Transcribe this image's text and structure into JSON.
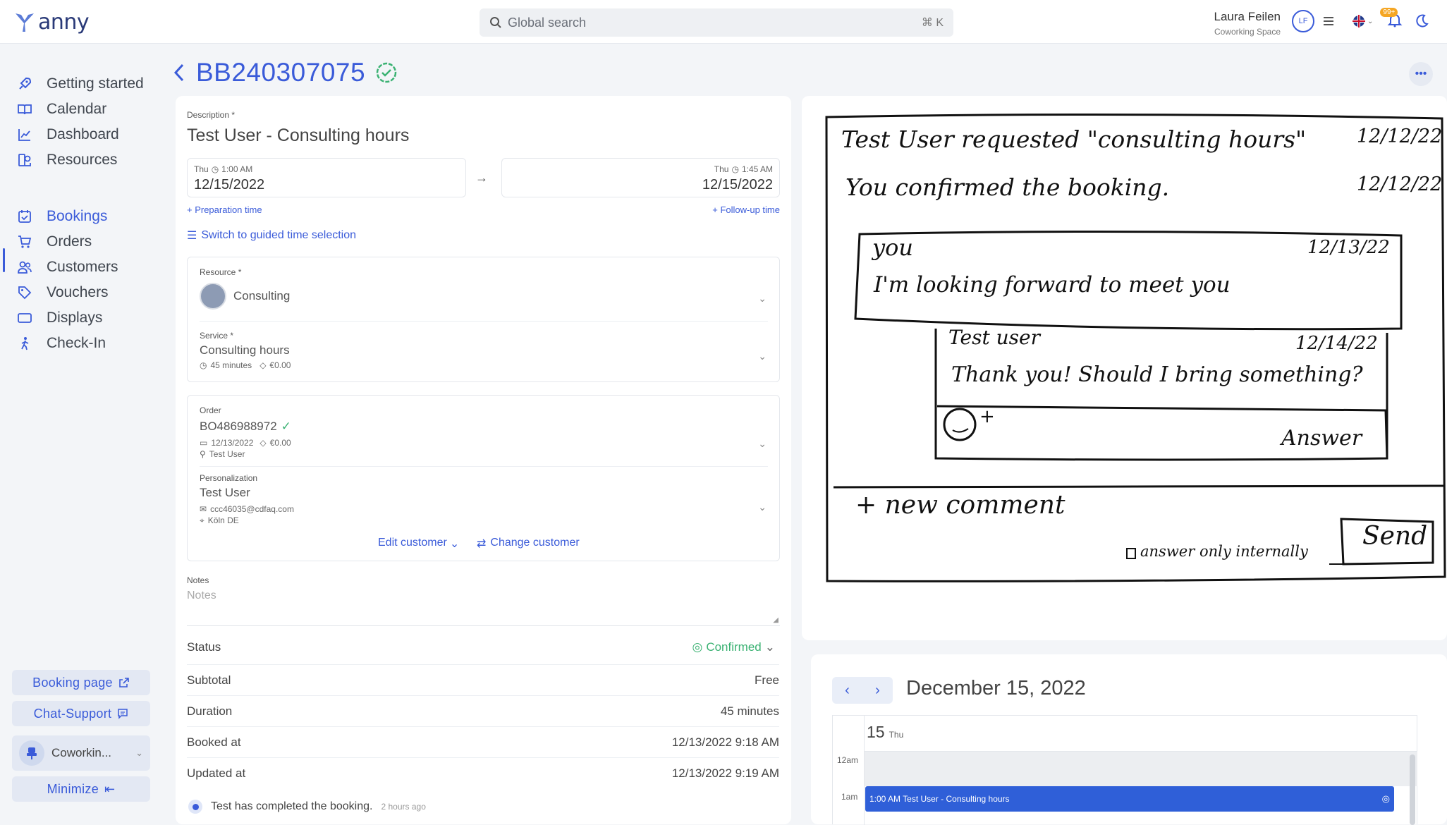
{
  "topbar": {
    "logo_text": "anny",
    "search_placeholder": "Global search",
    "search_shortcut": "⌘ K",
    "user_name": "Laura Feilen",
    "user_space": "Coworking Space",
    "user_initials": "LF",
    "notif_badge": "99+"
  },
  "sidebar": {
    "items": [
      {
        "label": "Getting started",
        "icon": "rocket-icon"
      },
      {
        "label": "Calendar",
        "icon": "book-open-icon"
      },
      {
        "label": "Dashboard",
        "icon": "chart-line-icon"
      },
      {
        "label": "Resources",
        "icon": "resources-icon"
      },
      {
        "label": "Bookings",
        "icon": "calendar-check-icon",
        "active": true
      },
      {
        "label": "Orders",
        "icon": "cart-icon"
      },
      {
        "label": "Customers",
        "icon": "users-icon"
      },
      {
        "label": "Vouchers",
        "icon": "tag-icon"
      },
      {
        "label": "Displays",
        "icon": "display-icon"
      },
      {
        "label": "Check-In",
        "icon": "walk-icon"
      }
    ],
    "booking_page": "Booking page",
    "chat_support": "Chat-Support",
    "space_name": "Coworkin...",
    "minimize": "Minimize"
  },
  "booking": {
    "id": "BB240307075",
    "description_label": "Description *",
    "description": "Test User - Consulting hours",
    "start_day": "Thu",
    "start_time": "1:00 AM",
    "start_date": "12/15/2022",
    "end_day": "Thu",
    "end_time": "1:45 AM",
    "end_date": "12/15/2022",
    "preparation_time": "+ Preparation time",
    "followup_time": "+ Follow-up time",
    "guided_time": "Switch to guided time selection",
    "resource_label": "Resource *",
    "resource": "Consulting",
    "service_label": "Service *",
    "service": "Consulting hours",
    "service_duration": "45 minutes",
    "service_price": "€0.00",
    "order_label": "Order",
    "order_id": "BO486988972",
    "order_date": "12/13/2022",
    "order_price": "€0.00",
    "order_user": "Test User",
    "personalization_label": "Personalization",
    "customer_name": "Test User",
    "customer_email": "ccc46035@cdfaq.com",
    "customer_location": "Köln DE",
    "edit_customer": "Edit customer",
    "change_customer": "Change customer",
    "notes_label": "Notes",
    "notes_placeholder": "Notes",
    "status_label": "Status",
    "status_value": "Confirmed",
    "subtotal_label": "Subtotal",
    "subtotal_value": "Free",
    "duration_label": "Duration",
    "duration_value": "45 minutes",
    "booked_at_label": "Booked at",
    "booked_at_value": "12/13/2022 9:18 AM",
    "updated_at_label": "Updated at",
    "updated_at_value": "12/13/2022 9:19 AM",
    "activity_text": "Test has completed the booking.",
    "activity_time": "2 hours ago"
  },
  "sketch": {
    "line1": "Test User requested \"consulting hours\"",
    "line1_date": "12/12/22",
    "line2": "You confirmed the booking.",
    "line2_date": "12/12/22",
    "comment1_author": "you",
    "comment1_date": "12/13/22",
    "comment1_text": "I'm looking forward to meet you",
    "comment2_author": "Test user",
    "comment2_date": "12/14/22",
    "comment2_text": "Thank you! Should I bring something?",
    "answer": "Answer",
    "new_comment": "+ new comment",
    "internal": "answer only internally",
    "send": "Send"
  },
  "calendar": {
    "title": "December 15, 2022",
    "day_number": "15",
    "day_name": "Thu",
    "hour_12am": "12am",
    "hour_1am": "1am",
    "event": "1:00 AM Test User - Consulting hours"
  },
  "colors": {
    "accent": "#3a5bd9",
    "success": "#3bb273",
    "event": "#2f5fd8"
  }
}
